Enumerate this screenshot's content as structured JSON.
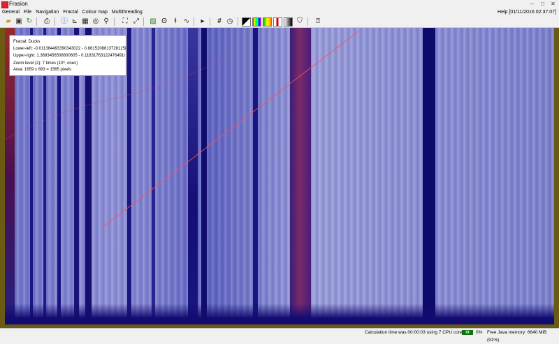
{
  "window": {
    "title": "Frasion"
  },
  "menubar": {
    "items": [
      "General",
      "File",
      "Navigation",
      "Fractal",
      "Colour map",
      "Multithreading"
    ],
    "help": "Help [01/11/2016 02:37:07]"
  },
  "toolbar": {
    "icons": [
      "folder-open-icon",
      "save-icon",
      "refresh-icon",
      "print-icon",
      "info-icon",
      "ruler-icon",
      "grid-icon",
      "target-icon",
      "zoom-icon",
      "fit-in-icon",
      "fit-out-icon",
      "image-icon",
      "spiral-icon",
      "curve-icon",
      "bookmark-icon",
      "hash-icon",
      "clock-icon",
      "palette-bw-icon",
      "palette-rainbow-icon",
      "palette-gradient-icon",
      "palette-red-icon",
      "palette-sharp-icon",
      "filter-icon",
      "help-icon"
    ]
  },
  "info": {
    "fractal": "Fractal: Ducks",
    "lower_left": "Lower-left: -0.011364493390343022 - 0.8615208613728125i",
    "upper_right": "Upper-right: 1.3693456508600605 - 0.11831763122476491i",
    "zoom": "Zoom level (2): 7 times (10⁰, ones)",
    "area": "Area: 1659 x 893 = 1565 pixels"
  },
  "status": {
    "calc_time": "Calculation time was 00:00:03 using 7 CPU cores",
    "cpu_percent": "0%",
    "memory": "Free Java memory: 6640 MiB (91%)"
  }
}
